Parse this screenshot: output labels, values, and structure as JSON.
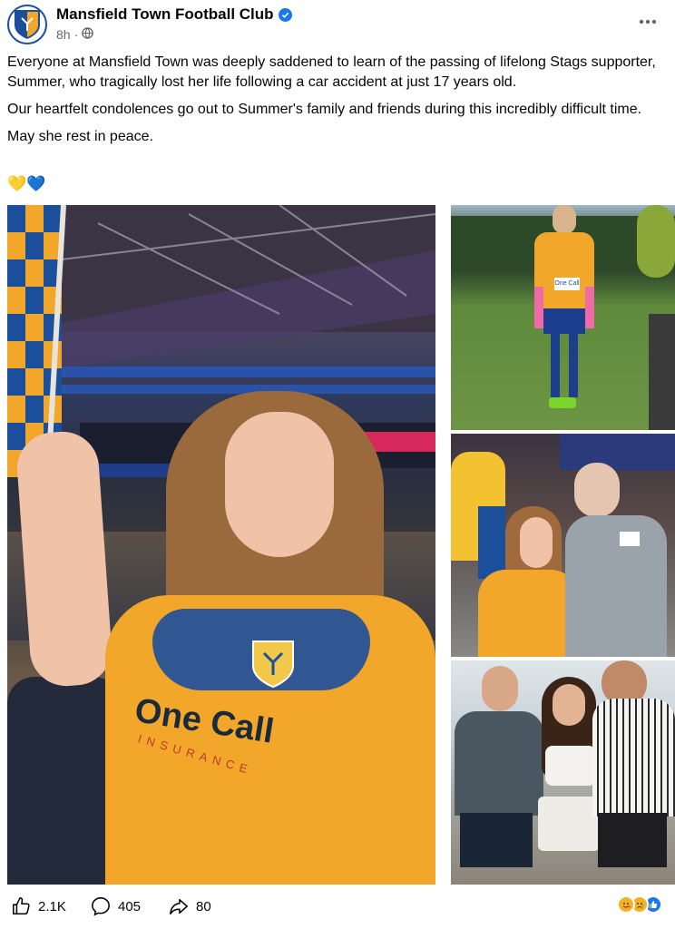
{
  "post": {
    "page_name": "Mansfield Town Football Club",
    "time_ago": "8h",
    "paragraphs": [
      "Everyone at Mansfield Town was deeply saddened to learn of the passing of lifelong Stags supporter, Summer, who tragically lost her life following a car accident at just 17 years old.",
      "Our heartfelt condolences go out to Summer's family and friends during this incredibly difficult time.",
      "May she rest in peace."
    ],
    "emojis": "💛💙"
  },
  "photos": {
    "main_shirt_sponsor": "One Call",
    "main_shirt_sub": "INSURANCE",
    "tr_shirt_sponsor": "One Call"
  },
  "engagement": {
    "likes": "2.1K",
    "comments": "405",
    "shares": "80"
  },
  "colors": {
    "brand_blue": "#1b4f9c",
    "amber": "#f2a72a",
    "verified": "#1877f2"
  },
  "icons": [
    "globe-icon",
    "verified-icon",
    "more-icon",
    "like-icon",
    "comment-icon",
    "share-icon",
    "care-reaction",
    "sad-reaction",
    "like-reaction"
  ]
}
